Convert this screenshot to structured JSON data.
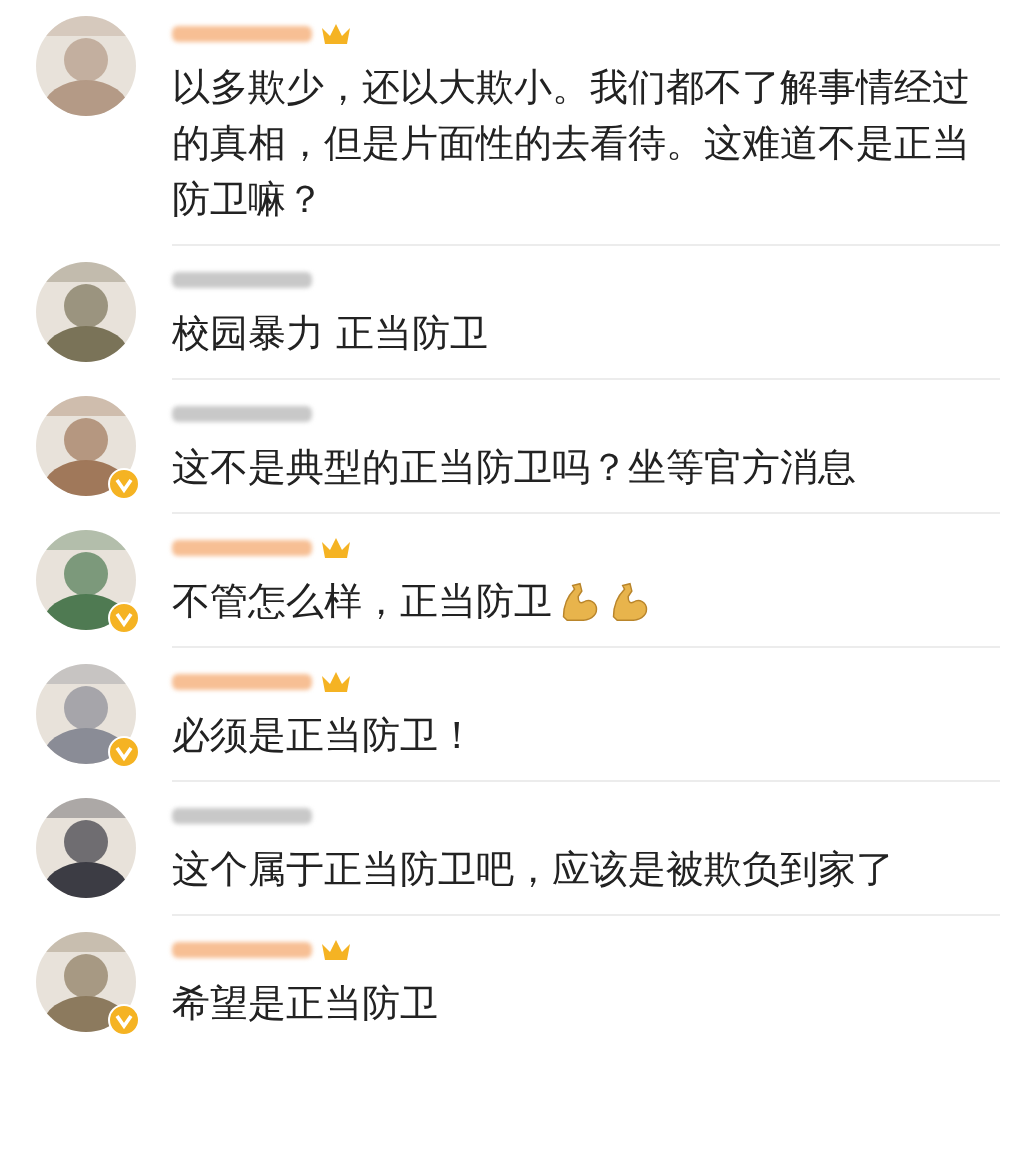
{
  "comments": [
    {
      "vip": true,
      "crown": true,
      "avatar_badge": false,
      "text": "以多欺少，还以大欺小。我们都不了解事情经过的真相，但是片面性的去看待。这难道不是正当防卫嘛？"
    },
    {
      "vip": false,
      "crown": false,
      "avatar_badge": false,
      "text": "校园暴力  正当防卫"
    },
    {
      "vip": false,
      "crown": false,
      "avatar_badge": true,
      "text": "这不是典型的正当防卫吗？坐等官方消息"
    },
    {
      "vip": true,
      "crown": true,
      "avatar_badge": true,
      "text": "不管怎么样，正当防卫",
      "reactions": [
        {
          "kind": "flex"
        },
        {
          "kind": "flex"
        }
      ]
    },
    {
      "vip": true,
      "crown": true,
      "avatar_badge": true,
      "text": "必须是正当防卫！"
    },
    {
      "vip": false,
      "crown": false,
      "avatar_badge": false,
      "text": "这个属于正当防卫吧，应该是被欺负到家了"
    },
    {
      "vip": true,
      "crown": true,
      "avatar_badge": true,
      "text": "希望是正当防卫"
    }
  ]
}
